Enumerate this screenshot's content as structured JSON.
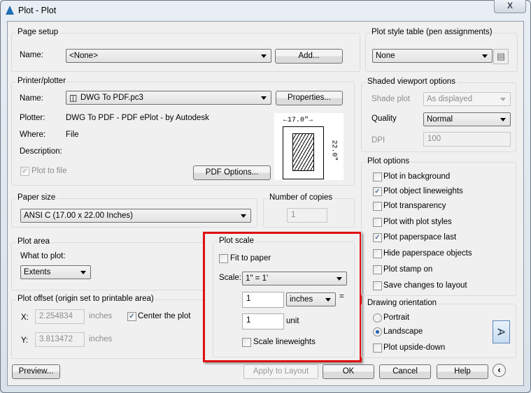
{
  "window": {
    "title": "Plot - Plot",
    "close": "X"
  },
  "page_setup": {
    "legend": "Page setup",
    "name_label": "Name:",
    "name_value": "<None>",
    "add": "Add..."
  },
  "plot_style": {
    "legend": "Plot style table (pen assignments)",
    "value": "None"
  },
  "printer": {
    "legend": "Printer/plotter",
    "name_label": "Name:",
    "name_value": "DWG To PDF.pc3",
    "properties": "Properties...",
    "plotter_label": "Plotter:",
    "plotter_value": "DWG To PDF - PDF ePlot - by Autodesk",
    "where_label": "Where:",
    "where_value": "File",
    "description_label": "Description:",
    "plot_to_file": "Plot to file",
    "plot_to_file_checked": true,
    "pdf_options": "PDF Options...",
    "preview_width": "17.0″",
    "preview_height": "22.0″"
  },
  "paper_size": {
    "legend": "Paper size",
    "value": "ANSI C (17.00 x 22.00 Inches)"
  },
  "copies": {
    "legend": "Number of copies",
    "value": "1"
  },
  "plot_area": {
    "legend": "Plot area",
    "what_label": "What to plot:",
    "what_value": "Extents"
  },
  "plot_offset": {
    "legend": "Plot offset (origin set to printable area)",
    "x_label": "X:",
    "x_value": "2.254834",
    "y_label": "Y:",
    "y_value": "3.813472",
    "unit": "inches",
    "center": "Center the plot",
    "center_checked": true
  },
  "plot_scale": {
    "legend": "Plot scale",
    "fit": "Fit to paper",
    "fit_checked": false,
    "scale_label": "Scale:",
    "scale_value": "1\" = 1'",
    "value1": "1",
    "unit1": "inches",
    "equals": "=",
    "value2": "1",
    "unit2": "unit",
    "lineweights": "Scale lineweights",
    "lineweights_checked": false,
    "highlight_color": "#e01010"
  },
  "shaded": {
    "legend": "Shaded viewport options",
    "shade_label": "Shade plot",
    "shade_value": "As displayed",
    "quality_label": "Quality",
    "quality_value": "Normal",
    "dpi_label": "DPI",
    "dpi_value": "100"
  },
  "plot_options": {
    "legend": "Plot options",
    "items": [
      {
        "label": "Plot in background",
        "checked": false
      },
      {
        "label": "Plot object lineweights",
        "checked": true
      },
      {
        "label": "Plot transparency",
        "checked": false
      },
      {
        "label": "Plot with plot styles",
        "checked": false
      },
      {
        "label": "Plot paperspace last",
        "checked": true
      },
      {
        "label": "Hide paperspace objects",
        "checked": false
      },
      {
        "label": "Plot stamp on",
        "checked": false
      },
      {
        "label": "Save changes to layout",
        "checked": false
      }
    ]
  },
  "orientation": {
    "legend": "Drawing orientation",
    "portrait": "Portrait",
    "landscape": "Landscape",
    "selected": "Landscape",
    "upside_down": "Plot upside-down",
    "upside_down_checked": false,
    "icon_letter": "A"
  },
  "buttons": {
    "preview": "Preview...",
    "apply": "Apply to Layout",
    "ok": "OK",
    "cancel": "Cancel",
    "help": "Help"
  }
}
